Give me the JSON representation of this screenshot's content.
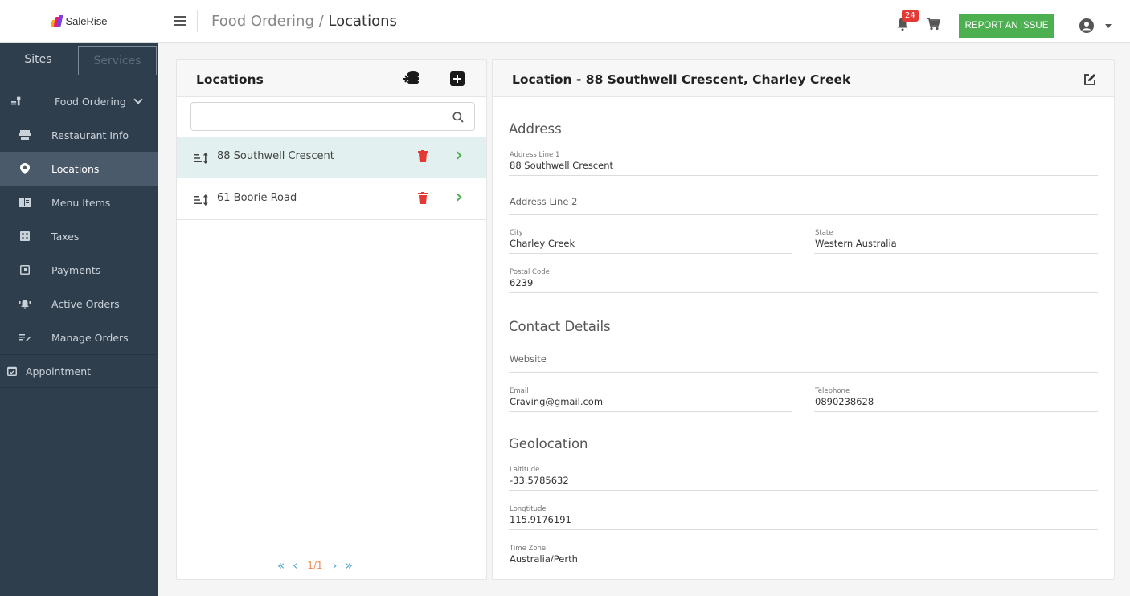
{
  "app": {
    "logo_text": "SaleRise"
  },
  "sidebar": {
    "tabs": [
      {
        "label": "Sites"
      },
      {
        "label": "Services"
      }
    ],
    "parent_label": "Food Ordering",
    "items": [
      {
        "label": "Restaurant Info",
        "icon": "store-icon"
      },
      {
        "label": "Locations",
        "icon": "map-pin-icon"
      },
      {
        "label": "Menu Items",
        "icon": "menu-book-icon"
      },
      {
        "label": "Taxes",
        "icon": "calculator-icon"
      },
      {
        "label": "Payments",
        "icon": "payment-icon"
      },
      {
        "label": "Active Orders",
        "icon": "bell-ring-icon"
      },
      {
        "label": "Manage Orders",
        "icon": "edit-list-icon"
      }
    ],
    "appointment_label": "Appointment"
  },
  "header": {
    "breadcrumb_parent": "Food Ordering",
    "breadcrumb_separator": " / ",
    "breadcrumb_current": "Locations",
    "notification_count": "24",
    "report_button": "REPORT AN ISSUE"
  },
  "locations_panel": {
    "title": "Locations",
    "search_placeholder": "",
    "items": [
      {
        "name": "88 Southwell Crescent",
        "selected": true
      },
      {
        "name": "61 Boorie Road",
        "selected": false
      }
    ],
    "pagination": "1/1"
  },
  "detail": {
    "title": "Location - 88 Southwell Crescent, Charley Creek",
    "address_section": "Address",
    "address_line1_label": "Address Line 1",
    "address_line1": "88 Southwell Crescent",
    "address_line2_placeholder": "Address Line 2",
    "city_label": "City",
    "city": "Charley Creek",
    "state_label": "State",
    "state": "Western Australia",
    "postal_label": "Postal Code",
    "postal": "6239",
    "contact_section": "Contact Details",
    "website_placeholder": "Website",
    "email_label": "Email",
    "email": "Craving@gmail.com",
    "telephone_label": "Telephone",
    "telephone": "0890238628",
    "geo_section": "Geolocation",
    "latitude_label": "Laititude",
    "latitude": "-33.5785632",
    "longitude_label": "Longtitude",
    "longitude": "115.9176191",
    "timezone_label": "Time Zone",
    "timezone": "Australia/Perth"
  },
  "colors": {
    "sidebar_bg": "#2f3e4d",
    "sidebar_active": "#4a5a6b",
    "accent_green": "#4caf50",
    "danger_red": "#e53935",
    "selected_row": "#e2f1ef"
  }
}
